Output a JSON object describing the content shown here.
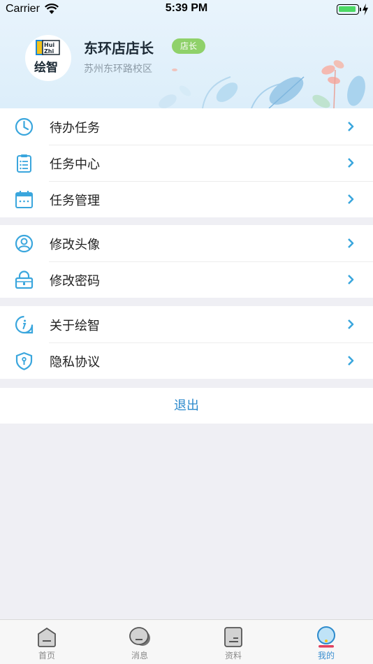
{
  "status_bar": {
    "carrier": "Carrier",
    "time": "5:39 PM"
  },
  "profile": {
    "avatar_logo_text": "Hui Zhi 绘智",
    "name": "东环店店长",
    "role": "店长",
    "campus": "苏州东环路校区"
  },
  "menu_groups": [
    {
      "items": [
        {
          "label": "待办任务",
          "icon": "clock-icon"
        },
        {
          "label": "任务中心",
          "icon": "clipboard-icon"
        },
        {
          "label": "任务管理",
          "icon": "calendar-icon"
        }
      ]
    },
    {
      "items": [
        {
          "label": "修改头像",
          "icon": "user-avatar-icon"
        },
        {
          "label": "修改密码",
          "icon": "lock-icon"
        }
      ]
    },
    {
      "items": [
        {
          "label": "关于绘智",
          "icon": "info-icon"
        },
        {
          "label": "隐私协议",
          "icon": "shield-icon"
        }
      ]
    }
  ],
  "logout_label": "退出",
  "tabbar": {
    "tabs": [
      {
        "label": "首页",
        "icon": "home-icon",
        "active": false
      },
      {
        "label": "消息",
        "icon": "message-icon",
        "active": false
      },
      {
        "label": "资料",
        "icon": "document-icon",
        "active": false
      },
      {
        "label": "我的",
        "icon": "profile-icon",
        "active": true
      }
    ]
  },
  "colors": {
    "accent": "#2c8acc",
    "badge": "#8fd16a",
    "header_bg": "#e3f1fb",
    "icon_blue": "#3aa6dd"
  }
}
